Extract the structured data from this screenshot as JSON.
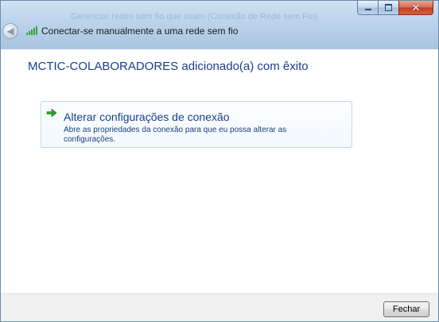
{
  "window": {
    "title": "Conectar-se manualmente a uma rede sem fio",
    "caption_buttons": {
      "minimize_icon": "minimize-icon",
      "maximize_icon": "maximize-icon",
      "close_glyph": "✕"
    }
  },
  "background": {
    "ghost_text_1": "Gerenciar redes sem fio que usam (Conexão de Rede sem Fio)"
  },
  "content": {
    "heading": "MCTIC-COLABORADORES adicionado(a) com êxito",
    "command_link": {
      "title": "Alterar configurações de conexão",
      "description": "Abre as propriedades da conexão para que eu possa alterar as configurações.",
      "icon": "green-arrow-icon"
    }
  },
  "footer": {
    "close_label": "Fechar"
  },
  "colors": {
    "heading_blue": "#1a3e8c",
    "link_border": "#b9dbea",
    "arrow_green": "#2f9e2f"
  }
}
